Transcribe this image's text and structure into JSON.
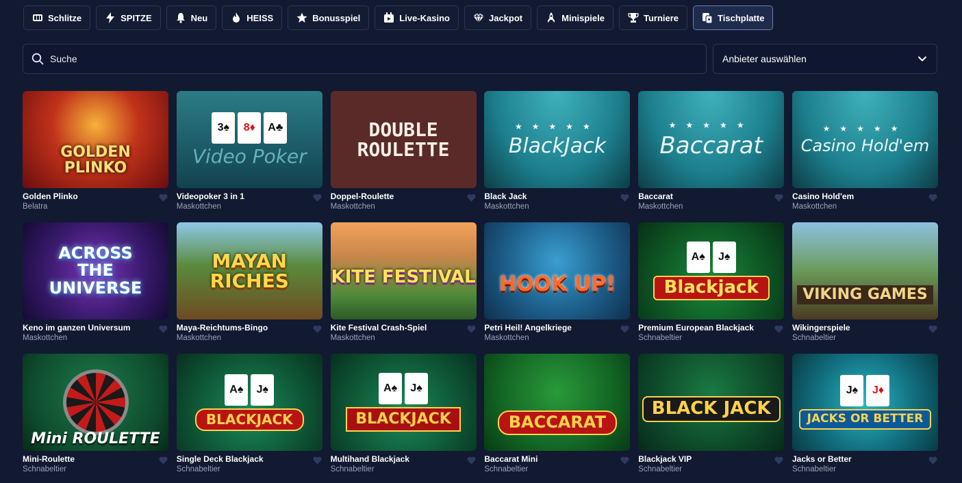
{
  "tabs": [
    {
      "label": "Schlitze",
      "icon": "slot-icon",
      "active": false
    },
    {
      "label": "SPITZE",
      "icon": "lightning-icon",
      "active": false
    },
    {
      "label": "Neu",
      "icon": "bell-icon",
      "active": false
    },
    {
      "label": "HEISS",
      "icon": "flame-icon",
      "active": false
    },
    {
      "label": "Bonusspiel",
      "icon": "star-icon",
      "active": false
    },
    {
      "label": "Live-Kasino",
      "icon": "live-icon",
      "active": false
    },
    {
      "label": "Jackpot",
      "icon": "diamond-icon",
      "active": false
    },
    {
      "label": "Minispiele",
      "icon": "rocket-icon",
      "active": false
    },
    {
      "label": "Turniere",
      "icon": "trophy-icon",
      "active": false
    },
    {
      "label": "Tischplatte",
      "icon": "table-icon",
      "active": true
    }
  ],
  "search": {
    "placeholder": "Suche"
  },
  "provider_select": {
    "label": "Anbieter auswählen"
  },
  "games": [
    {
      "name": "Golden Plinko",
      "provider": "Belatra",
      "art": "GOLDEN PLINKO"
    },
    {
      "name": "Videopoker 3 in 1",
      "provider": "Maskottchen",
      "art": "Video Poker"
    },
    {
      "name": "Doppel-Roulette",
      "provider": "Maskottchen",
      "art": "DOUBLE ROULETTE"
    },
    {
      "name": "Black Jack",
      "provider": "Maskottchen",
      "art": "BlackJack"
    },
    {
      "name": "Baccarat",
      "provider": "Maskottchen",
      "art": "Baccarat"
    },
    {
      "name": "Casino Hold'em",
      "provider": "Maskottchen",
      "art": "Casino Hold'em"
    },
    {
      "name": "Keno im ganzen Universum",
      "provider": "Maskottchen",
      "art": "ACROSS THE UNIVERSE"
    },
    {
      "name": "Maya-Reichtums-Bingo",
      "provider": "Maskottchen",
      "art": "MAYAN RICHES"
    },
    {
      "name": "Kite Festival Crash-Spiel",
      "provider": "Maskottchen",
      "art": "KITE FESTIVAL"
    },
    {
      "name": "Petri Heil! Angelkriege",
      "provider": "Maskottchen",
      "art": "HOOK UP!"
    },
    {
      "name": "Premium European Blackjack",
      "provider": "Schnabeltier",
      "art": "Blackjack"
    },
    {
      "name": "Wikingerspiele",
      "provider": "Schnabeltier",
      "art": "VIKING GAMES"
    },
    {
      "name": "Mini-Roulette",
      "provider": "Schnabeltier",
      "art": "Mini ROULETTE"
    },
    {
      "name": "Single Deck Blackjack",
      "provider": "Schnabeltier",
      "art": "BLACKJACK"
    },
    {
      "name": "Multihand Blackjack",
      "provider": "Schnabeltier",
      "art": "BLACKJACK"
    },
    {
      "name": "Baccarat Mini",
      "provider": "Schnabeltier",
      "art": "BACCARAT"
    },
    {
      "name": "Blackjack VIP",
      "provider": "Schnabeltier",
      "art": "BLACK JACK"
    },
    {
      "name": "Jacks or Better",
      "provider": "Schnabeltier",
      "art": "JACKS OR BETTER"
    }
  ]
}
